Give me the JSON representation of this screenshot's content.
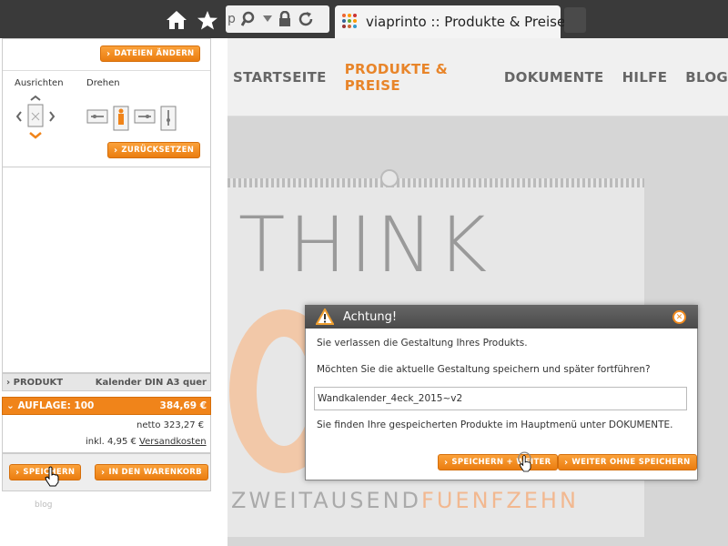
{
  "browser": {
    "url_partial": "p",
    "tab_title": "viaprinto :: Produkte & Preise",
    "tab_close": "×"
  },
  "nav": {
    "items": [
      "STARTSEITE",
      "PRODUKTE & PREISE",
      "DOKUMENTE",
      "HILFE",
      "BLOG"
    ],
    "active_index": 1
  },
  "canvas": {
    "headline": "THINK",
    "footer_gray": "ZWEITAUSEND",
    "footer_orange": "FUENFZEHN"
  },
  "sidebar": {
    "files_button": "DATEIEN ÄNDERN",
    "align_label": "Ausrichten",
    "rotate_label": "Drehen",
    "reset_button": "ZURÜCKSETZEN",
    "product_label": "PRODUKT",
    "product_value": "Kalender DIN A3 quer",
    "quantity_label": "AUFLAGE: 100",
    "quantity_price": "384,69 €",
    "netto": "netto 323,27 €",
    "inkl_prefix": "inkl. 4,95 €",
    "shipping_link": "Versandkosten",
    "save_button": "SPEICHERN",
    "cart_button": "IN DEN WARENKORB",
    "footer_link": "blog"
  },
  "dialog": {
    "title": "Achtung!",
    "message1": "Sie verlassen die Gestaltung Ihres Produkts.",
    "message2": "Möchten Sie die aktuelle Gestaltung speichern und später fortführen?",
    "filename_value": "Wandkalender_4eck_2015~v2",
    "message3": "Sie finden Ihre gespeicherten Produkte im Hauptmenü unter DOKUMENTE.",
    "save_continue_button": "SPEICHERN + WEITER",
    "continue_without_button": "WEITER OHNE SPEICHERN"
  },
  "colors": {
    "accent": "#f0841a",
    "chrome": "#3a3a3a",
    "nav_active": "#e8852a"
  }
}
